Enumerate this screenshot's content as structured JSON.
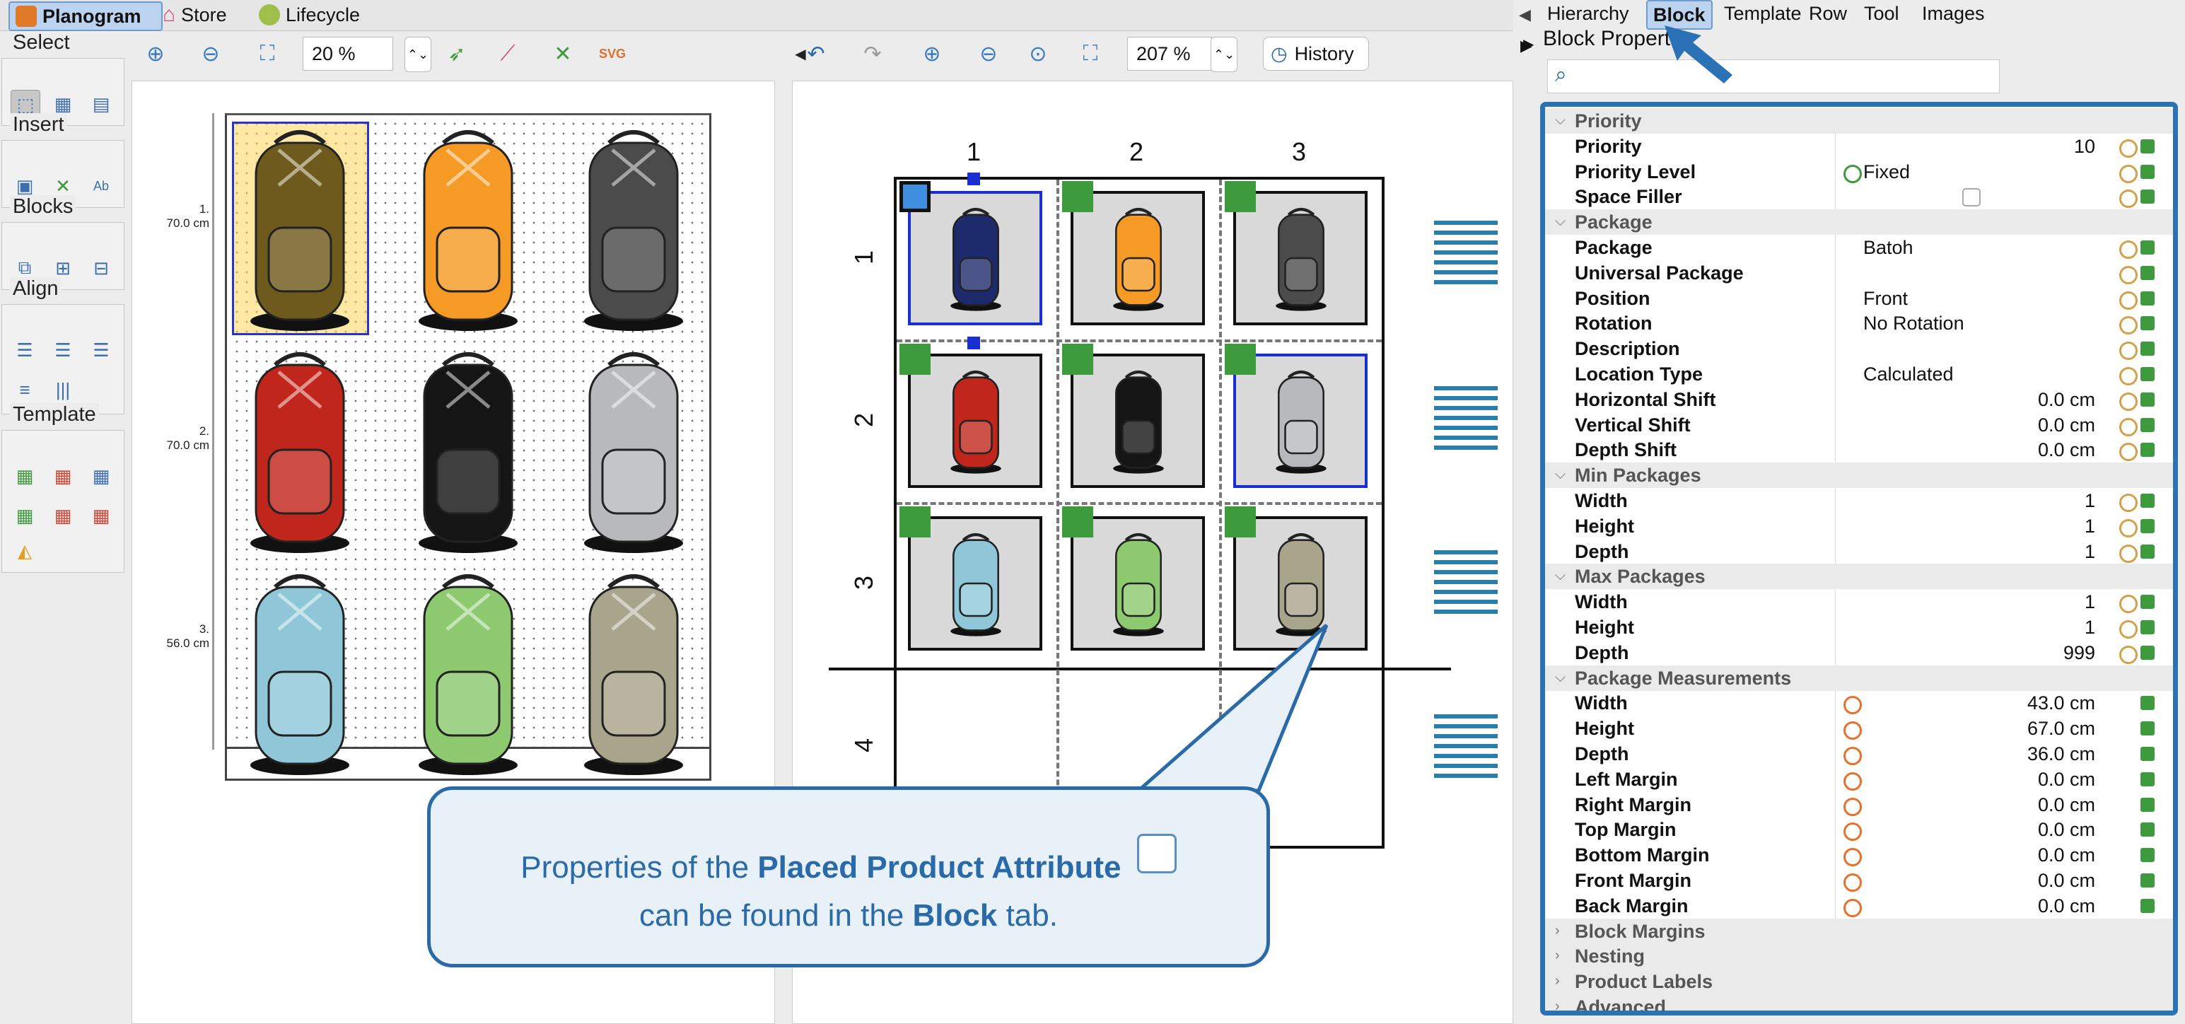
{
  "top_tabs": {
    "planogram": "Planogram",
    "store": "Store",
    "lifecycle": "Lifecycle"
  },
  "left_tools": {
    "select": "Select",
    "insert": "Insert",
    "blocks": "Blocks",
    "align": "Align",
    "template": "Template"
  },
  "planogram_toolbar": {
    "zoom": "20 %",
    "svg_label": "SVG"
  },
  "planogram_rulers": {
    "s1": "1.",
    "s1_h": "70.0 cm",
    "s2": "2.",
    "s2_h": "70.0 cm",
    "s3": "3.",
    "s3_h": "56.0 cm"
  },
  "planogram_products": [
    {
      "color": "#6f5a1e"
    },
    {
      "color": "#f59a24"
    },
    {
      "color": "#4b4b4b"
    },
    {
      "color": "#c0261b"
    },
    {
      "color": "#151515"
    },
    {
      "color": "#b7b9bd"
    },
    {
      "color": "#8fc7d9"
    },
    {
      "color": "#8dc96f"
    },
    {
      "color": "#a9a48c"
    }
  ],
  "block_toolbar": {
    "zoom": "207 %",
    "history": "History"
  },
  "block_grid": {
    "cols": [
      "1",
      "2",
      "3"
    ],
    "rows": [
      "1",
      "2",
      "3",
      "4"
    ],
    "cells": [
      {
        "color": "#1d2a6b"
      },
      {
        "color": "#f59a24"
      },
      {
        "color": "#4b4b4b"
      },
      {
        "color": "#c0261b"
      },
      {
        "color": "#151515"
      },
      {
        "color": "#b7b9bd"
      },
      {
        "color": "#8fc7d9"
      },
      {
        "color": "#8dc96f"
      },
      {
        "color": "#a9a48c"
      }
    ]
  },
  "right_tabs": [
    "Hierarchy",
    "Block",
    "Template",
    "Row",
    "Tool",
    "Images"
  ],
  "properties_title": "Block Propert",
  "search": {
    "placeholder": ""
  },
  "properties": {
    "priority_group": "Priority",
    "priority": {
      "label": "Priority",
      "value": "10"
    },
    "priority_level": {
      "label": "Priority Level",
      "value": "Fixed"
    },
    "space_filler": {
      "label": "Space Filler"
    },
    "package_group": "Package",
    "package": {
      "label": "Package",
      "value": "Batoh"
    },
    "universal_package": {
      "label": "Universal Package"
    },
    "position": {
      "label": "Position",
      "value": "Front"
    },
    "rotation": {
      "label": "Rotation",
      "value": "No Rotation"
    },
    "description": {
      "label": "Description"
    },
    "location_type": {
      "label": "Location Type",
      "value": "Calculated"
    },
    "horizontal_shift": {
      "label": "Horizontal Shift",
      "value": "0.0 cm"
    },
    "vertical_shift": {
      "label": "Vertical Shift",
      "value": "0.0 cm"
    },
    "depth_shift": {
      "label": "Depth Shift",
      "value": "0.0 cm"
    },
    "min_group": "Min Packages",
    "min_width": {
      "label": "Width",
      "value": "1"
    },
    "min_height": {
      "label": "Height",
      "value": "1"
    },
    "min_depth": {
      "label": "Depth",
      "value": "1"
    },
    "max_group": "Max Packages",
    "max_width": {
      "label": "Width",
      "value": "1"
    },
    "max_height": {
      "label": "Height",
      "value": "1"
    },
    "max_depth": {
      "label": "Depth",
      "value": "999"
    },
    "meas_group": "Package Measurements",
    "m_width": {
      "label": "Width",
      "value": "43.0 cm"
    },
    "m_height": {
      "label": "Height",
      "value": "67.0 cm"
    },
    "m_depth": {
      "label": "Depth",
      "value": "36.0 cm"
    },
    "left_margin": {
      "label": "Left Margin",
      "value": "0.0 cm"
    },
    "right_margin": {
      "label": "Right Margin",
      "value": "0.0 cm"
    },
    "top_margin": {
      "label": "Top Margin",
      "value": "0.0 cm"
    },
    "bottom_margin": {
      "label": "Bottom Margin",
      "value": "0.0 cm"
    },
    "front_margin": {
      "label": "Front Margin",
      "value": "0.0 cm"
    },
    "back_margin": {
      "label": "Back Margin",
      "value": "0.0 cm"
    },
    "block_margins_group": "Block Margins",
    "nesting_group": "Nesting",
    "product_labels_group": "Product Labels",
    "advanced_group": "Advanced"
  },
  "callout": {
    "line1_prefix": "Properties of the ",
    "line1_bold": "Placed Product Attribute",
    "line2_prefix": "can be found in the ",
    "line2_bold": "Block",
    "line2_suffix": " tab."
  },
  "colors": {
    "accent": "#2a72b5",
    "green_marker": "#3d9a3d",
    "selection": "#1a2fd0"
  }
}
